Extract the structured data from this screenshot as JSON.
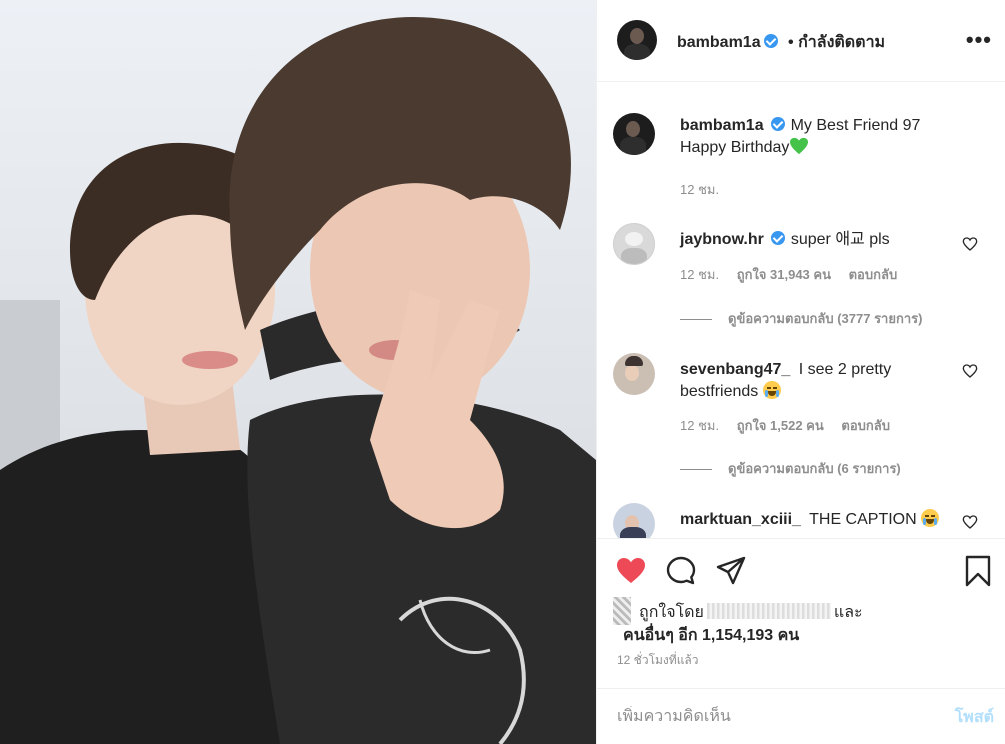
{
  "post": {
    "author": "bambam1a",
    "follow_separator": "•",
    "follow_status": "กำลังติดตาม",
    "more_icon": "•••",
    "caption_line1": "My Best Friend 97",
    "caption_line2": "Happy Birthday",
    "caption_time": "12 ชม."
  },
  "comments": [
    {
      "username": "jaybnow.hr",
      "verified": true,
      "text": "super 애교 pls",
      "time": "12 ชม.",
      "likes": "ถูกใจ 31,943 คน",
      "reply": "ตอบกลับ",
      "view_replies": "ดูข้อความตอบกลับ (3777 รายการ)"
    },
    {
      "username": "sevenbang47_",
      "verified": false,
      "text_line1": "I see 2 pretty",
      "text_line2": "bestfriends",
      "time": "12 ชม.",
      "likes": "ถูกใจ 1,522 คน",
      "reply": "ตอบกลับ",
      "view_replies": "ดูข้อความตอบกลับ (6 รายการ)"
    },
    {
      "username": "marktuan_xciii_",
      "verified": false,
      "text": "THE CAPTION"
    }
  ],
  "likes_section": {
    "liked_by_prefix": "ถูกใจโดย",
    "and": "และ",
    "others": "คนอื่นๆ อีก 1,154,193 คน"
  },
  "time_ago": "12 ชั่วโมงที่แล้ว",
  "comment_input": {
    "placeholder": "เพิ่มความคิดเห็น",
    "post_label": "โพสต์"
  },
  "colors": {
    "liked_heart": "#ed4956",
    "verified": "#3897f0",
    "post_button_disabled": "#b2dffc",
    "green_heart": "#44c24a"
  }
}
